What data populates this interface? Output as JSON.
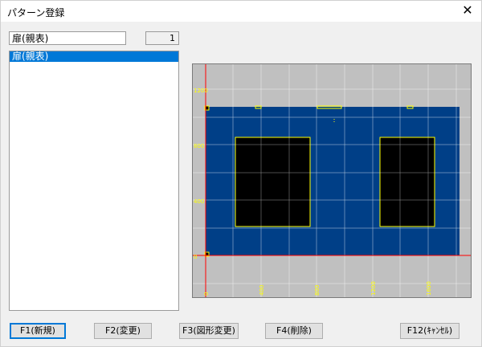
{
  "window": {
    "title": "パターン登録",
    "close_glyph": "✕"
  },
  "pattern_name": {
    "value": "扉(親表)"
  },
  "counter": {
    "value": "1"
  },
  "pattern_list": {
    "items": [
      {
        "label": "扉(親表)",
        "selected": true
      }
    ]
  },
  "preview": {
    "y_labels": [
      "1200",
      "800",
      "400",
      "0"
    ],
    "x_labels": [
      "0",
      "400",
      "800",
      "1200",
      "1600"
    ],
    "colors": {
      "background": "#c0c0c0",
      "panel": "#003f87",
      "grid": "#ffffff",
      "axis": "#ff0000",
      "outline": "#ffff00",
      "label": "#ffff00",
      "opening": "#000000"
    }
  },
  "buttons": {
    "f1": "F1(新規)",
    "f2": "F2(変更)",
    "f3": "F3(図形変更)",
    "f4": "F4(削除)",
    "f12": "F12(ｷｬﾝｾﾙ)"
  }
}
